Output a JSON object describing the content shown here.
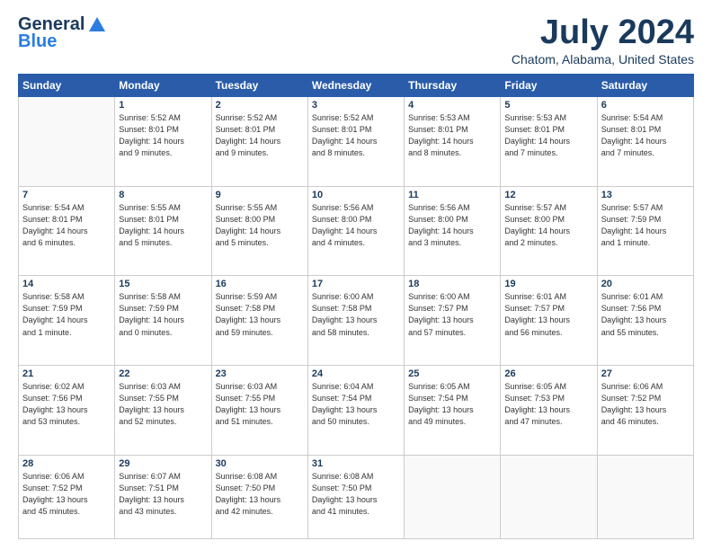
{
  "logo": {
    "line1": "General",
    "line2": "Blue"
  },
  "title": "July 2024",
  "location": "Chatom, Alabama, United States",
  "days_of_week": [
    "Sunday",
    "Monday",
    "Tuesday",
    "Wednesday",
    "Thursday",
    "Friday",
    "Saturday"
  ],
  "weeks": [
    [
      {
        "day": "",
        "info": ""
      },
      {
        "day": "1",
        "info": "Sunrise: 5:52 AM\nSunset: 8:01 PM\nDaylight: 14 hours\nand 9 minutes."
      },
      {
        "day": "2",
        "info": "Sunrise: 5:52 AM\nSunset: 8:01 PM\nDaylight: 14 hours\nand 9 minutes."
      },
      {
        "day": "3",
        "info": "Sunrise: 5:52 AM\nSunset: 8:01 PM\nDaylight: 14 hours\nand 8 minutes."
      },
      {
        "day": "4",
        "info": "Sunrise: 5:53 AM\nSunset: 8:01 PM\nDaylight: 14 hours\nand 8 minutes."
      },
      {
        "day": "5",
        "info": "Sunrise: 5:53 AM\nSunset: 8:01 PM\nDaylight: 14 hours\nand 7 minutes."
      },
      {
        "day": "6",
        "info": "Sunrise: 5:54 AM\nSunset: 8:01 PM\nDaylight: 14 hours\nand 7 minutes."
      }
    ],
    [
      {
        "day": "7",
        "info": "Sunrise: 5:54 AM\nSunset: 8:01 PM\nDaylight: 14 hours\nand 6 minutes."
      },
      {
        "day": "8",
        "info": "Sunrise: 5:55 AM\nSunset: 8:01 PM\nDaylight: 14 hours\nand 5 minutes."
      },
      {
        "day": "9",
        "info": "Sunrise: 5:55 AM\nSunset: 8:00 PM\nDaylight: 14 hours\nand 5 minutes."
      },
      {
        "day": "10",
        "info": "Sunrise: 5:56 AM\nSunset: 8:00 PM\nDaylight: 14 hours\nand 4 minutes."
      },
      {
        "day": "11",
        "info": "Sunrise: 5:56 AM\nSunset: 8:00 PM\nDaylight: 14 hours\nand 3 minutes."
      },
      {
        "day": "12",
        "info": "Sunrise: 5:57 AM\nSunset: 8:00 PM\nDaylight: 14 hours\nand 2 minutes."
      },
      {
        "day": "13",
        "info": "Sunrise: 5:57 AM\nSunset: 7:59 PM\nDaylight: 14 hours\nand 1 minute."
      }
    ],
    [
      {
        "day": "14",
        "info": "Sunrise: 5:58 AM\nSunset: 7:59 PM\nDaylight: 14 hours\nand 1 minute."
      },
      {
        "day": "15",
        "info": "Sunrise: 5:58 AM\nSunset: 7:59 PM\nDaylight: 14 hours\nand 0 minutes."
      },
      {
        "day": "16",
        "info": "Sunrise: 5:59 AM\nSunset: 7:58 PM\nDaylight: 13 hours\nand 59 minutes."
      },
      {
        "day": "17",
        "info": "Sunrise: 6:00 AM\nSunset: 7:58 PM\nDaylight: 13 hours\nand 58 minutes."
      },
      {
        "day": "18",
        "info": "Sunrise: 6:00 AM\nSunset: 7:57 PM\nDaylight: 13 hours\nand 57 minutes."
      },
      {
        "day": "19",
        "info": "Sunrise: 6:01 AM\nSunset: 7:57 PM\nDaylight: 13 hours\nand 56 minutes."
      },
      {
        "day": "20",
        "info": "Sunrise: 6:01 AM\nSunset: 7:56 PM\nDaylight: 13 hours\nand 55 minutes."
      }
    ],
    [
      {
        "day": "21",
        "info": "Sunrise: 6:02 AM\nSunset: 7:56 PM\nDaylight: 13 hours\nand 53 minutes."
      },
      {
        "day": "22",
        "info": "Sunrise: 6:03 AM\nSunset: 7:55 PM\nDaylight: 13 hours\nand 52 minutes."
      },
      {
        "day": "23",
        "info": "Sunrise: 6:03 AM\nSunset: 7:55 PM\nDaylight: 13 hours\nand 51 minutes."
      },
      {
        "day": "24",
        "info": "Sunrise: 6:04 AM\nSunset: 7:54 PM\nDaylight: 13 hours\nand 50 minutes."
      },
      {
        "day": "25",
        "info": "Sunrise: 6:05 AM\nSunset: 7:54 PM\nDaylight: 13 hours\nand 49 minutes."
      },
      {
        "day": "26",
        "info": "Sunrise: 6:05 AM\nSunset: 7:53 PM\nDaylight: 13 hours\nand 47 minutes."
      },
      {
        "day": "27",
        "info": "Sunrise: 6:06 AM\nSunset: 7:52 PM\nDaylight: 13 hours\nand 46 minutes."
      }
    ],
    [
      {
        "day": "28",
        "info": "Sunrise: 6:06 AM\nSunset: 7:52 PM\nDaylight: 13 hours\nand 45 minutes."
      },
      {
        "day": "29",
        "info": "Sunrise: 6:07 AM\nSunset: 7:51 PM\nDaylight: 13 hours\nand 43 minutes."
      },
      {
        "day": "30",
        "info": "Sunrise: 6:08 AM\nSunset: 7:50 PM\nDaylight: 13 hours\nand 42 minutes."
      },
      {
        "day": "31",
        "info": "Sunrise: 6:08 AM\nSunset: 7:50 PM\nDaylight: 13 hours\nand 41 minutes."
      },
      {
        "day": "",
        "info": ""
      },
      {
        "day": "",
        "info": ""
      },
      {
        "day": "",
        "info": ""
      }
    ]
  ]
}
